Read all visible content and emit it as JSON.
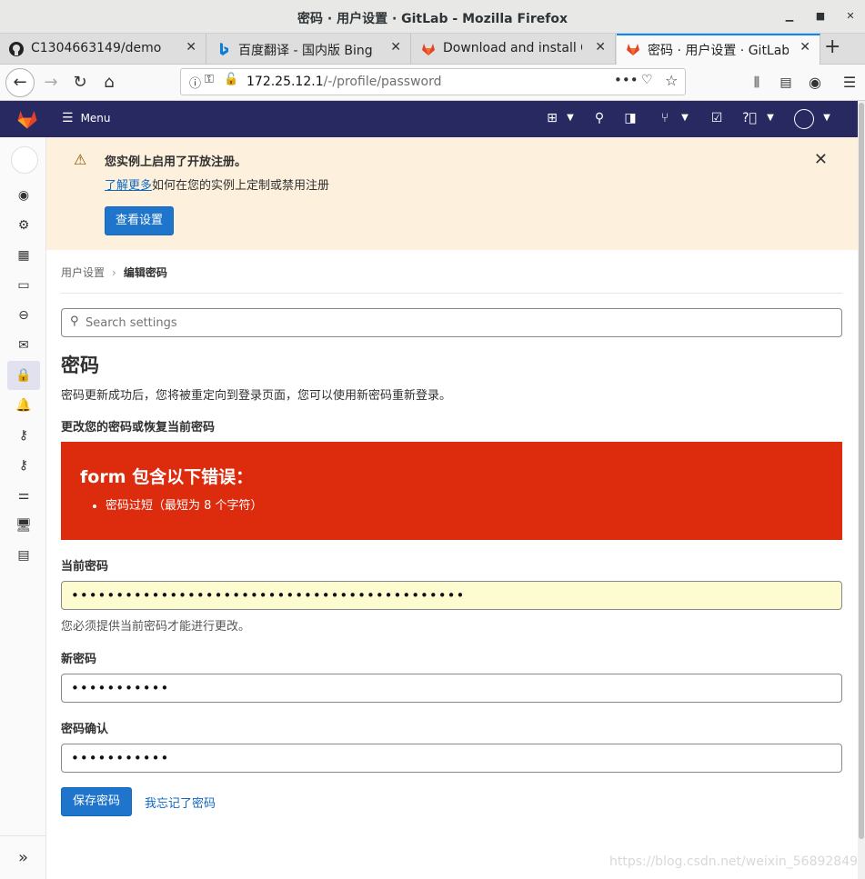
{
  "window": {
    "title": "密码 · 用户设置 · GitLab - Mozilla Firefox"
  },
  "tabs": [
    {
      "label": "C1304663149/demo",
      "icon": "github-icon"
    },
    {
      "label": "百度翻译 - 国内版 Bing",
      "icon": "bing-icon"
    },
    {
      "label": "Download and install GitL",
      "icon": "gitlab-icon"
    },
    {
      "label": "密码 · 用户设置 · GitLab",
      "icon": "gitlab-icon",
      "active": true
    }
  ],
  "navbar": {
    "url_host": "172.25.12.1",
    "url_path": "/-/profile/password"
  },
  "header": {
    "menu_label": "Menu"
  },
  "banner": {
    "heading": "您实例上启用了开放注册。",
    "link_text": "了解更多",
    "body_text": "如何在您的实例上定制或禁用注册",
    "button_label": "查看设置"
  },
  "breadcrumb": {
    "parent": "用户设置",
    "current": "编辑密码"
  },
  "search": {
    "placeholder": "Search settings"
  },
  "page": {
    "title": "密码",
    "description": "密码更新成功后，您将被重定向到登录页面，您可以使用新密码重新登录。",
    "subheading": "更改您的密码或恢复当前密码"
  },
  "error": {
    "heading": "form 包含以下错误：",
    "items": [
      "密码过短（最短为 8 个字符）"
    ]
  },
  "form": {
    "current_label": "当前密码",
    "current_value": "••••••••••••••••••••••••••••••••••••••••••••",
    "current_help": "您必须提供当前密码才能进行更改。",
    "new_label": "新密码",
    "new_value": "•••••••••••",
    "confirm_label": "密码确认",
    "confirm_value": "•••••••••••",
    "save_label": "保存密码",
    "forgot_label": "我忘记了密码"
  },
  "watermark": "https://blog.csdn.net/weixin_56892849",
  "colors": {
    "header": "#292961",
    "banner": "#fdf1dd",
    "error": "#dd2b0e",
    "primary": "#1f75cb"
  }
}
